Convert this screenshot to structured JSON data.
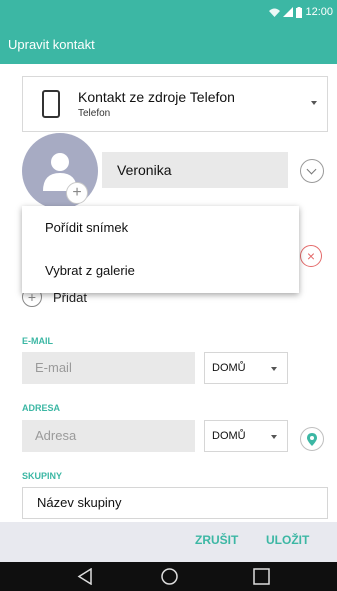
{
  "status_bar": {
    "time": "12:00",
    "colors": {
      "accent": "#3cb7a4"
    },
    "icons": [
      "wifi-icon",
      "signal-icon",
      "battery-icon"
    ]
  },
  "app_bar": {
    "title": "Upravit kontakt"
  },
  "account_source": {
    "title": "Kontakt ze zdroje Telefon",
    "subtitle": "Telefon",
    "icon": "phone-icon"
  },
  "name": {
    "value": "Veronika"
  },
  "photo_menu": {
    "items": [
      "Pořídit snímek",
      "Vybrat z galerie"
    ]
  },
  "add_field": {
    "label": "Přidat"
  },
  "email": {
    "section_label": "E-MAIL",
    "placeholder": "E-mail",
    "type": "DOMŮ"
  },
  "address": {
    "section_label": "ADRESA",
    "placeholder": "Adresa",
    "type": "DOMŮ"
  },
  "groups": {
    "section_label": "SKUPINY",
    "value": "Název skupiny"
  },
  "actions": {
    "cancel": "ZRUŠIT",
    "save": "ULOŽIT"
  },
  "nav_bar": {
    "icons": [
      "back-icon",
      "home-icon",
      "recents-icon"
    ]
  }
}
